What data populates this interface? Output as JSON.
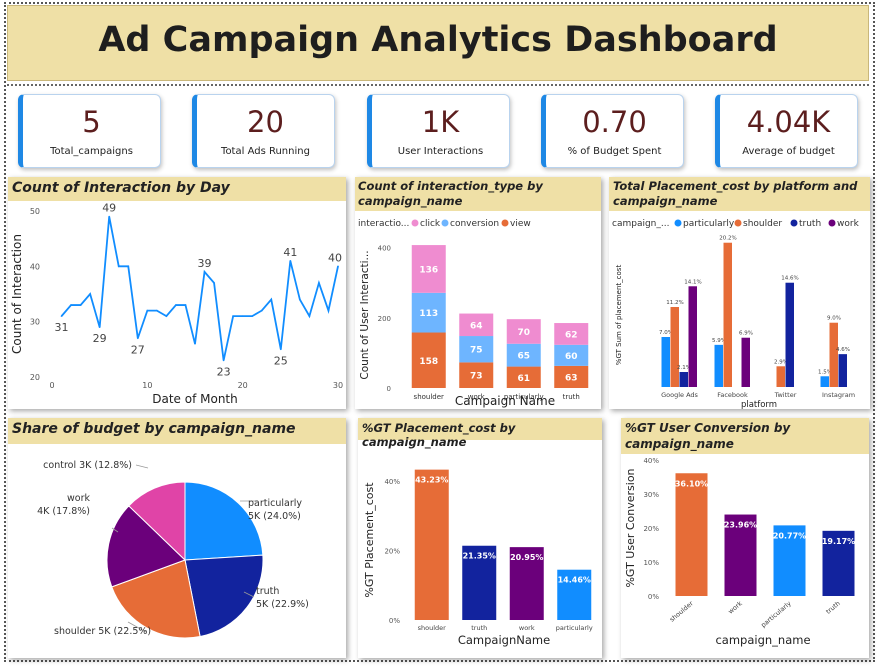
{
  "dashboard": {
    "title": "Ad Campaign Analytics Dashboard"
  },
  "kpis": [
    {
      "value": "5",
      "label": "Total_campaigns"
    },
    {
      "value": "20",
      "label": "Total Ads Running"
    },
    {
      "value": "1K",
      "label": "User Interactions"
    },
    {
      "value": "0.70",
      "label": "% of Budget Spent"
    },
    {
      "value": "4.04K",
      "label": "Average of budget"
    }
  ],
  "panels": {
    "line": "Count of Interaction by Day",
    "stack": "Count of interaction_type by campaign_name",
    "platform": "Total Placement_cost by platform and campaign_name",
    "pie": "Share of budget by campaign_name",
    "placement": "%GT Placement_cost by campaign_name",
    "conversion": "%GT User Conversion by campaign_name"
  },
  "colors": {
    "accent": "#1e88e5",
    "title_bg": "#efe0a6",
    "kpi_value": "#5c1e1e",
    "orange": "#e66c37",
    "blue": "#118dff",
    "navy": "#12239e",
    "purple": "#6b007b",
    "pink": "#e044a7",
    "light_blue": "#6eb5ff",
    "light_pink": "#ef8cd0"
  },
  "chart_data": [
    {
      "type": "line",
      "xlabel": "Date of Month",
      "ylabel": "Count of Interaction",
      "xticks": [
        "0",
        "10",
        "20",
        "30"
      ],
      "yticks": [
        "20",
        "30",
        "40",
        "50"
      ],
      "xlim": [
        0,
        30
      ],
      "ylim": [
        20,
        50
      ],
      "x": [
        1,
        2,
        3,
        4,
        5,
        6,
        7,
        8,
        9,
        10,
        11,
        12,
        13,
        14,
        15,
        16,
        17,
        18,
        19,
        20,
        21,
        22,
        23,
        24,
        25,
        26,
        27,
        28,
        29,
        30
      ],
      "y": [
        31,
        33,
        33,
        35,
        29,
        49,
        40,
        40,
        27,
        32,
        32,
        31,
        33,
        33,
        26,
        39,
        37,
        23,
        31,
        31,
        31,
        32,
        34,
        25,
        41,
        34,
        31,
        37,
        32,
        40
      ],
      "labels": [
        {
          "x": 1,
          "y": 31,
          "text": "31"
        },
        {
          "x": 5,
          "y": 29,
          "text": "29"
        },
        {
          "x": 6,
          "y": 49,
          "text": "49"
        },
        {
          "x": 9,
          "y": 27,
          "text": "27"
        },
        {
          "x": 16,
          "y": 39,
          "text": "39"
        },
        {
          "x": 18,
          "y": 23,
          "text": "23"
        },
        {
          "x": 24,
          "y": 25,
          "text": "25"
        },
        {
          "x": 25,
          "y": 41,
          "text": "41"
        },
        {
          "x": 30,
          "y": 40,
          "text": "40"
        }
      ],
      "color": "#118dff"
    },
    {
      "type": "bar",
      "stacked": true,
      "legend_title": "interactio...",
      "xlabel": "Campaign Name",
      "ylabel": "Count of User Interacti...",
      "yticks": [
        "0",
        "200",
        "400"
      ],
      "ylim": [
        0,
        430
      ],
      "categories": [
        "shoulder",
        "work",
        "particularly",
        "truth"
      ],
      "series": [
        {
          "name": "view",
          "values": [
            158,
            73,
            61,
            63
          ],
          "color": "#e66c37"
        },
        {
          "name": "conversion",
          "values": [
            113,
            75,
            65,
            60
          ],
          "color": "#6eb5ff"
        },
        {
          "name": "click",
          "values": [
            136,
            64,
            70,
            62
          ],
          "color": "#ef8cd0"
        }
      ],
      "legend_order": [
        "click",
        "conversion",
        "view"
      ]
    },
    {
      "type": "bar",
      "legend_title": "campaign_...",
      "xlabel": "platform",
      "ylabel": "%GT Sum of placement_cost",
      "ylim": [
        0,
        21
      ],
      "categories": [
        "Google Ads",
        "Facebook",
        "Twitter",
        "Instagram"
      ],
      "series": [
        {
          "name": "particularly",
          "values": [
            7.0,
            5.9,
            null,
            1.5
          ],
          "color": "#118dff"
        },
        {
          "name": "shoulder",
          "values": [
            11.2,
            20.2,
            2.9,
            9.0
          ],
          "color": "#e66c37"
        },
        {
          "name": "truth",
          "values": [
            2.1,
            null,
            14.6,
            4.6
          ],
          "color": "#12239e"
        },
        {
          "name": "work",
          "values": [
            14.1,
            6.9,
            null,
            null
          ],
          "color": "#6b007b"
        }
      ],
      "value_labels": [
        [
          "7.0%",
          "5.9%",
          "",
          "1.5%"
        ],
        [
          "11.2%",
          "20.2%",
          "2.9%",
          "9.0%"
        ],
        [
          "2.1%",
          "",
          "14.6%",
          "4.6%"
        ],
        [
          "14.1%",
          "6.9%",
          "",
          ""
        ]
      ]
    },
    {
      "type": "pie",
      "slices": [
        {
          "name": "particularly",
          "label1": "particularly",
          "label2": "5K (24.0%)",
          "value": 24.0,
          "color": "#118dff"
        },
        {
          "name": "truth",
          "label1": "truth",
          "label2": "5K (22.9%)",
          "value": 22.9,
          "color": "#12239e"
        },
        {
          "name": "shoulder",
          "label1": "shoulder 5K (22.5%)",
          "label2": "",
          "value": 22.5,
          "color": "#e66c37"
        },
        {
          "name": "work",
          "label1": "work",
          "label2": "4K (17.8%)",
          "value": 17.8,
          "color": "#6b007b"
        },
        {
          "name": "control",
          "label1": "control 3K (12.8%)",
          "label2": "",
          "value": 12.8,
          "color": "#e044a7"
        }
      ]
    },
    {
      "type": "bar",
      "xlabel": "CampaignName",
      "ylabel": "%GT Placement_cost",
      "yticks": [
        "0%",
        "20%",
        "40%"
      ],
      "ylim": [
        0,
        46
      ],
      "categories": [
        "shoulder",
        "truth",
        "work",
        "particularly"
      ],
      "values": [
        43.23,
        21.35,
        20.95,
        14.46
      ],
      "value_labels": [
        "43.23%",
        "21.35%",
        "20.95%",
        "14.46%"
      ],
      "colors": [
        "#e66c37",
        "#12239e",
        "#6b007b",
        "#118dff"
      ]
    },
    {
      "type": "bar",
      "xlabel": "campaign_name",
      "ylabel": "%GT User Conversion",
      "yticks": [
        "0%",
        "10%",
        "20%",
        "30%",
        "40%"
      ],
      "ylim": [
        0,
        40
      ],
      "categories": [
        "shoulder",
        "work",
        "particularly",
        "truth"
      ],
      "values": [
        36.1,
        23.96,
        20.77,
        19.17
      ],
      "value_labels": [
        "36.10%",
        "23.96%",
        "20.77%",
        "19.17%"
      ],
      "colors": [
        "#e66c37",
        "#6b007b",
        "#118dff",
        "#12239e"
      ]
    }
  ]
}
